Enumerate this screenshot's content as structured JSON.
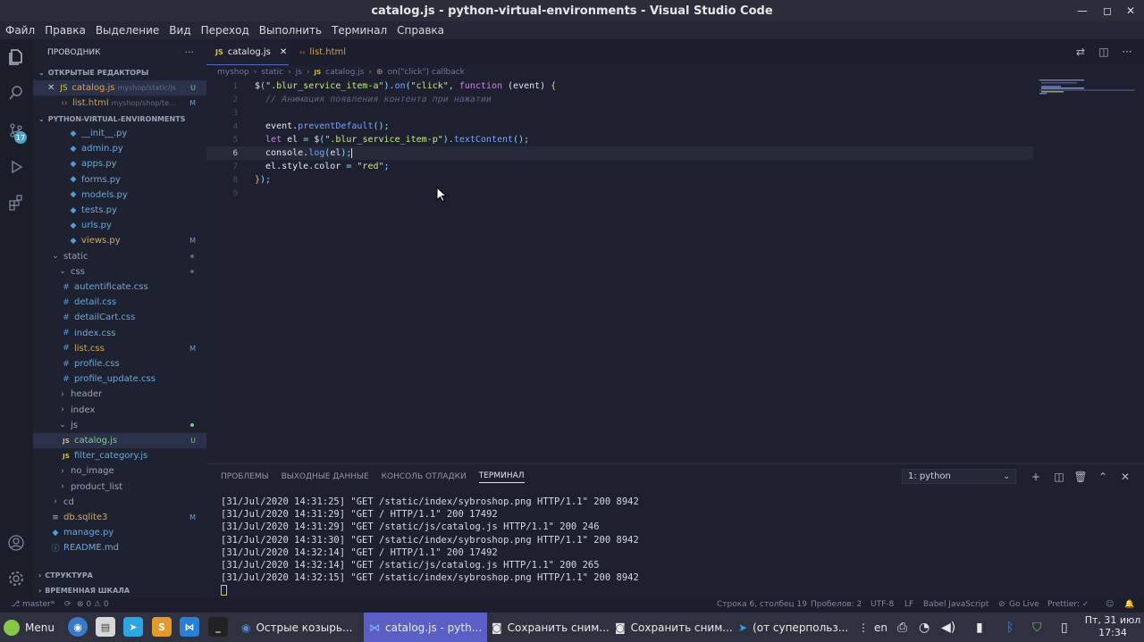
{
  "window": {
    "title": "catalog.js - python-virtual-environments - Visual Studio Code"
  },
  "menu": [
    "Файл",
    "Правка",
    "Выделение",
    "Вид",
    "Переход",
    "Выполнить",
    "Терминал",
    "Справка"
  ],
  "activity": {
    "scm_badge": "17"
  },
  "sidebar": {
    "header": "ПРОВОДНИК",
    "open_editors_title": "ОТКРЫТЫЕ РЕДАКТОРЫ",
    "open_editors": [
      {
        "name": "catalog.js",
        "path": "myshop/static/js",
        "status": "U"
      },
      {
        "name": "list.html",
        "path": "myshop/shop/te...",
        "status": "M"
      }
    ],
    "project_title": "PYTHON-VIRTUAL-ENVIRONMENTS",
    "files": [
      {
        "name": "__init__.py",
        "status": ""
      },
      {
        "name": "admin.py",
        "status": ""
      },
      {
        "name": "apps.py",
        "status": ""
      },
      {
        "name": "forms.py",
        "status": ""
      },
      {
        "name": "models.py",
        "status": ""
      },
      {
        "name": "tests.py",
        "status": ""
      },
      {
        "name": "urls.py",
        "status": ""
      },
      {
        "name": "views.py",
        "status": "M"
      },
      {
        "name": "static",
        "status": ""
      },
      {
        "name": "css",
        "status": ""
      },
      {
        "name": "autentificate.css",
        "status": ""
      },
      {
        "name": "detail.css",
        "status": ""
      },
      {
        "name": "detailCart.css",
        "status": ""
      },
      {
        "name": "index.css",
        "status": ""
      },
      {
        "name": "list.css",
        "status": "M"
      },
      {
        "name": "profile.css",
        "status": ""
      },
      {
        "name": "profile_update.css",
        "status": ""
      },
      {
        "name": "header",
        "status": ""
      },
      {
        "name": "index",
        "status": ""
      },
      {
        "name": "js",
        "status": ""
      },
      {
        "name": "catalog.js",
        "status": "U"
      },
      {
        "name": "filter_category.js",
        "status": ""
      },
      {
        "name": "no_image",
        "status": ""
      },
      {
        "name": "product_list",
        "status": ""
      },
      {
        "name": "cd",
        "status": ""
      },
      {
        "name": "db.sqlite3",
        "status": "M"
      },
      {
        "name": "manage.py",
        "status": ""
      },
      {
        "name": "README.md",
        "status": ""
      }
    ],
    "outline_title": "СТРУКТУРА",
    "timeline_title": "ВРЕМЕННАЯ ШКАЛА"
  },
  "tabs": [
    {
      "label": "catalog.js",
      "icon": "JS"
    },
    {
      "label": "list.html",
      "icon": "<>"
    }
  ],
  "breadcrumb": [
    "myshop",
    "static",
    "js",
    "catalog.js",
    "on(\"click\") callback"
  ],
  "editor": {
    "line_numbers": [
      "1",
      "2",
      "3",
      "4",
      "5",
      "6",
      "7",
      "8",
      "9"
    ],
    "lines": [
      "$(\".blur_service_item-a\").on(\"click\", function (event) {",
      "  // Анимация появления контента при нажатии",
      "",
      "  event.preventDefault();",
      "  let el = $(\".blur_service_item-p\").textContent();",
      "  console.log(el);",
      "  el.style.color = \"red\";",
      "});",
      ""
    ]
  },
  "panel": {
    "tabs": [
      "ПРОБЛЕМЫ",
      "ВЫХОДНЫЕ ДАННЫЕ",
      "КОНСОЛЬ ОТЛАДКИ",
      "ТЕРМИНАЛ"
    ],
    "terminal_select": "1: python",
    "terminal_lines": [
      "[31/Jul/2020 14:31:25] \"GET /static/index/sybroshop.png HTTP/1.1\" 200 8942",
      "[31/Jul/2020 14:31:29] \"GET / HTTP/1.1\" 200 17492",
      "[31/Jul/2020 14:31:29] \"GET /static/js/catalog.js HTTP/1.1\" 200 246",
      "[31/Jul/2020 14:31:30] \"GET /static/index/sybroshop.png HTTP/1.1\" 200 8942",
      "[31/Jul/2020 14:32:14] \"GET / HTTP/1.1\" 200 17492",
      "[31/Jul/2020 14:32:14] \"GET /static/js/catalog.js HTTP/1.1\" 200 265",
      "[31/Jul/2020 14:32:15] \"GET /static/index/sybroshop.png HTTP/1.1\" 200 8942"
    ]
  },
  "status": {
    "branch": "master*",
    "problems": "⊗ 0 ⚠ 0",
    "position": "Строка 6, столбец 19",
    "spaces": "Пробелов: 2",
    "encoding": "UTF-8",
    "eol": "LF",
    "language": "Babel JavaScript",
    "golive": "Go Live",
    "prettier": "Prettier: ✓"
  },
  "taskbar": {
    "menu": "Menu",
    "windows": [
      "Острые козырь...",
      "catalog.js - pyth...",
      "Сохранить сним...",
      "Сохранить сним...",
      "(от суперпольз..."
    ],
    "lang": "en",
    "date": "Пт, 31 июл",
    "time": "17:34"
  }
}
